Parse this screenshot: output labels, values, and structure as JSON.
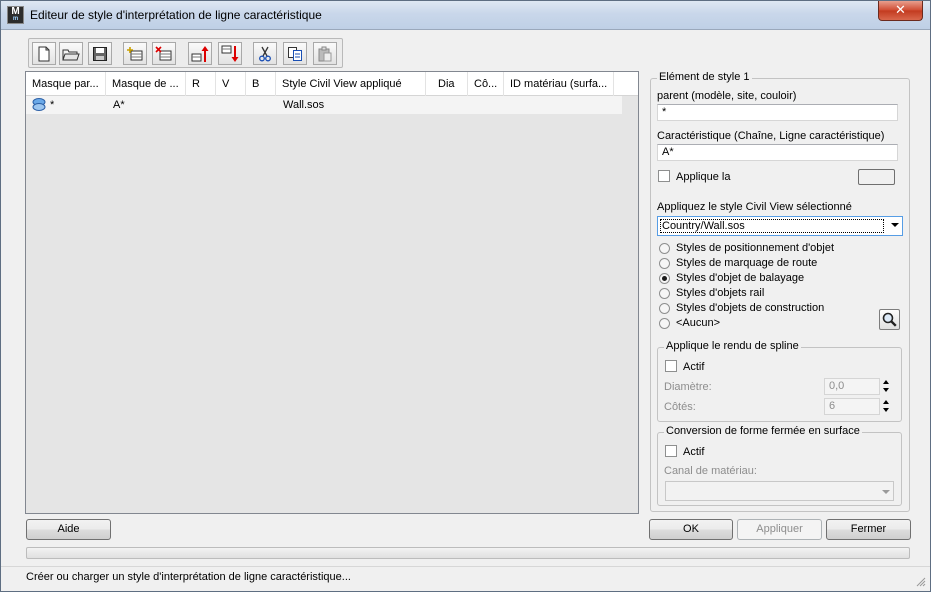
{
  "window": {
    "title": "Editeur de style d'interprétation de ligne caractéristique",
    "app_icon": {
      "letter": "M",
      "sub": "m"
    },
    "close_glyph": "✕"
  },
  "toolbar": {
    "buttons": [
      {
        "name": "new-icon"
      },
      {
        "name": "open-folder-icon"
      },
      {
        "name": "save-icon"
      },
      {
        "name": "add-row-icon"
      },
      {
        "name": "delete-row-icon"
      },
      {
        "name": "move-up-icon"
      },
      {
        "name": "move-down-icon"
      },
      {
        "name": "cut-icon"
      },
      {
        "name": "copy-icon"
      },
      {
        "name": "paste-icon"
      }
    ]
  },
  "list": {
    "columns": [
      "Masque par...",
      "Masque de ...",
      "R",
      "V",
      "B",
      "Style Civil View appliqué",
      "Dia",
      "Cô...",
      "ID matériau (surfa..."
    ],
    "rows": [
      {
        "icon": "layers-icon",
        "cells": [
          "*",
          "A*",
          "",
          "",
          "",
          "Wall.sos",
          "",
          "",
          ""
        ]
      }
    ]
  },
  "panel": {
    "group_title": "Elément de style 1",
    "parent_label": "parent (modèle, site, couloir)",
    "parent_value": "*",
    "feature_label": "Caractéristique (Chaîne, Ligne caractéristique)",
    "feature_value": "A*",
    "apply_color_label": "Applique la",
    "apply_style_label": "Appliquez le style Civil View sélectionné",
    "style_value": "Country/Wall.sos",
    "radios": [
      {
        "label": "Styles de positionnement d'objet",
        "checked": false
      },
      {
        "label": "Styles de marquage de route",
        "checked": false
      },
      {
        "label": "Styles d'objet de balayage",
        "checked": true
      },
      {
        "label": "Styles d'objets rail",
        "checked": false
      },
      {
        "label": "Styles d'objets de construction",
        "checked": false
      },
      {
        "label": "<Aucun>",
        "checked": false
      }
    ],
    "spline": {
      "title": "Applique le rendu de spline",
      "active_label": "Actif",
      "diameter_label": "Diamètre:",
      "diameter_value": "0,0",
      "sides_label": "Côtés:",
      "sides_value": "6"
    },
    "conversion": {
      "title": "Conversion de forme fermée en surface",
      "active_label": "Actif",
      "channel_label": "Canal de matériau:",
      "channel_value": ""
    }
  },
  "buttons": {
    "help": "Aide",
    "ok": "OK",
    "apply": "Appliquer",
    "close": "Fermer"
  },
  "status": {
    "text": "Créer ou charger un style d'interprétation de ligne caractéristique...",
    "progress": 0
  }
}
